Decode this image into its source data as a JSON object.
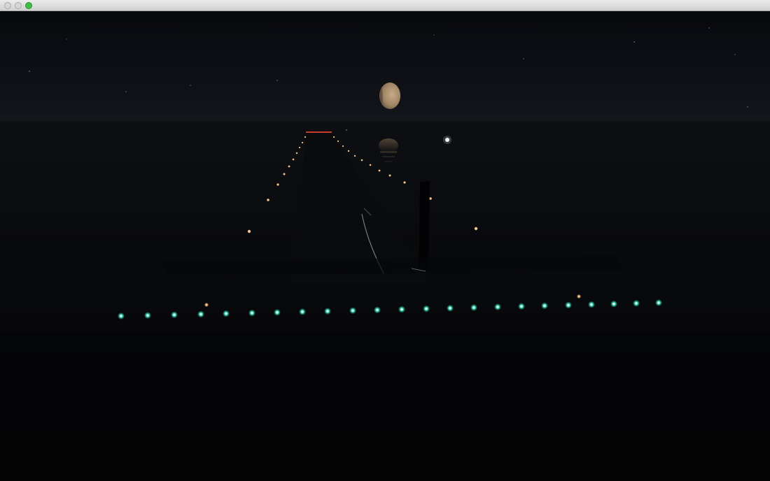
{
  "window": {
    "title": "",
    "controls": [
      {
        "name": "close-button",
        "color": "#d6d6d6"
      },
      {
        "name": "minimize-button",
        "color": "#d6d6d6"
      },
      {
        "name": "zoom-button",
        "color": "#3fbf3f"
      }
    ]
  },
  "scene": {
    "time_of_day": "night",
    "sky_color": "#0c0e14",
    "water_color": "#07080b",
    "moon_color": "#b59a7a",
    "runway_edge_light_color": "#f0c48a",
    "threshold_light_color": "#39e6c0",
    "threshold_bar_color": "#c83a2a"
  }
}
